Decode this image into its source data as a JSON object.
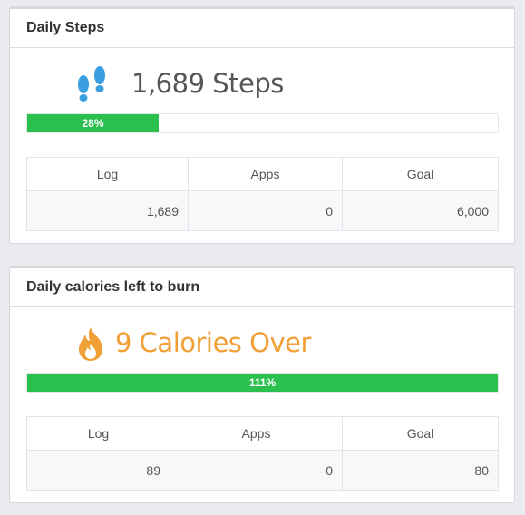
{
  "steps_card": {
    "title": "Daily Steps",
    "icon": "footprints-icon",
    "headline": "1,689 Steps",
    "progress_label": "28%",
    "progress_value": 0.28,
    "columns": [
      "Log",
      "Apps",
      "Goal"
    ],
    "values": [
      "1,689",
      "0",
      "6,000"
    ],
    "accent_color": "#3a9fe0"
  },
  "calories_card": {
    "title": "Daily calories left to burn",
    "icon": "flame-icon",
    "headline": "9 Calories Over",
    "progress_label": "111%",
    "progress_value": 1.0,
    "columns": [
      "Log",
      "Apps",
      "Goal"
    ],
    "values": [
      "89",
      "0",
      "80"
    ],
    "accent_color": "#f0a037"
  },
  "colors": {
    "progress_fill": "#2bbf4e"
  }
}
